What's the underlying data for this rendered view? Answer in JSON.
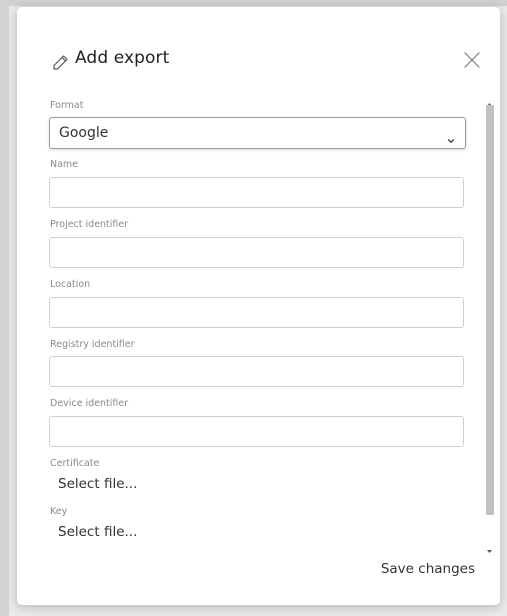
{
  "dialog": {
    "title": "Add export",
    "close_icon": "close-icon",
    "title_icon": "pencil-icon"
  },
  "form": {
    "format": {
      "label": "Format",
      "selected": "Google"
    },
    "name": {
      "label": "Name",
      "value": ""
    },
    "project_identifier": {
      "label": "Project identifier",
      "value": ""
    },
    "location": {
      "label": "Location",
      "value": ""
    },
    "registry_identifier": {
      "label": "Registry identifier",
      "value": ""
    },
    "device_identifier": {
      "label": "Device identifier",
      "value": ""
    },
    "certificate": {
      "label": "Certificate",
      "select_text": "Select file..."
    },
    "key": {
      "label": "Key",
      "select_text": "Select file..."
    }
  },
  "footer": {
    "save_label": "Save changes"
  },
  "colors": {
    "label_gray": "#8a8a8a",
    "input_border": "#cfcfcf",
    "scroll_thumb": "#c1c1c1"
  }
}
